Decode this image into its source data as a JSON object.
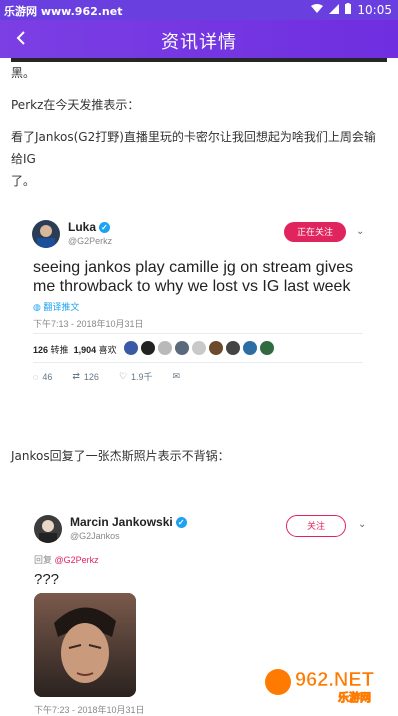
{
  "status": {
    "watermark": "乐游网 www.962.net",
    "time": "10:05"
  },
  "appbar": {
    "title": "资讯详情"
  },
  "article": {
    "top_fragment": "黑。",
    "para1": "Perkz在今天发推表示：",
    "para2a": "看了Jankos(G2打野)直播里玩的卡密尔让我回想起为啥我们上周会输给IG",
    "para2b": "了。",
    "para3": "Jankos回复了一张杰斯照片表示不背锅："
  },
  "tweet1": {
    "name": "Luka",
    "handle": "@G2Perkz",
    "follow_label": "正在关注",
    "text_line1": "seeing jankos play camille jg on stream gives",
    "text_line2": "me throwback to why we lost vs IG last week",
    "translate": "翻译推文",
    "timestamp": "下午7:13 - 2018年10月31日",
    "retweets_count": "126",
    "retweets_label": "转推",
    "likes_count": "1,904",
    "likes_label": "喜欢",
    "reply_count": "46",
    "retweet_action_count": "126",
    "like_action_count": "1.9千"
  },
  "tweet2": {
    "name": "Marcin Jankowski",
    "handle": "@G2Jankos",
    "follow_label": "关注",
    "reply_to_prefix": "回复",
    "reply_to_handle": "@G2Perkz",
    "text": "???",
    "timestamp": "下午7:23 - 2018年10月31日"
  },
  "brand_watermark": {
    "text": "962.NET",
    "sub": "乐游网"
  },
  "colors": {
    "accent": "#6f2ee0",
    "follow_pink": "#e0245e",
    "twitter_blue": "#1da1f2"
  }
}
